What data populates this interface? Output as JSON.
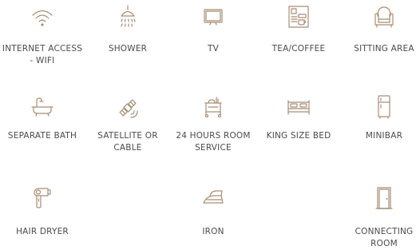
{
  "amenities": [
    {
      "label": "INTERNET ACCESS - WIFI",
      "icon": "wifi-icon"
    },
    {
      "label": "SHOWER",
      "icon": "shower-icon"
    },
    {
      "label": "TV",
      "icon": "tv-icon"
    },
    {
      "label": "TEA/COFFEE",
      "icon": "coffee-maker-icon"
    },
    {
      "label": "SITTING AREA",
      "icon": "armchair-icon"
    },
    {
      "label": "SEPARATE BATH",
      "icon": "bathtub-icon"
    },
    {
      "label": "SATELLITE OR CABLE",
      "icon": "satellite-icon"
    },
    {
      "label": "24 HOURS ROOM SERVICE",
      "icon": "room-service-cart-icon"
    },
    {
      "label": "KING SIZE BED",
      "icon": "bed-icon"
    },
    {
      "label": "MINIBAR",
      "icon": "fridge-icon"
    },
    {
      "label": "HAIR DRYER",
      "icon": "hair-dryer-icon"
    },
    {
      "label": "IRON",
      "icon": "iron-icon"
    },
    {
      "label": "CONNECTING ROOM",
      "icon": "door-icon"
    }
  ],
  "colors": {
    "icon": "#a88e74",
    "text": "#4b4b4b"
  }
}
